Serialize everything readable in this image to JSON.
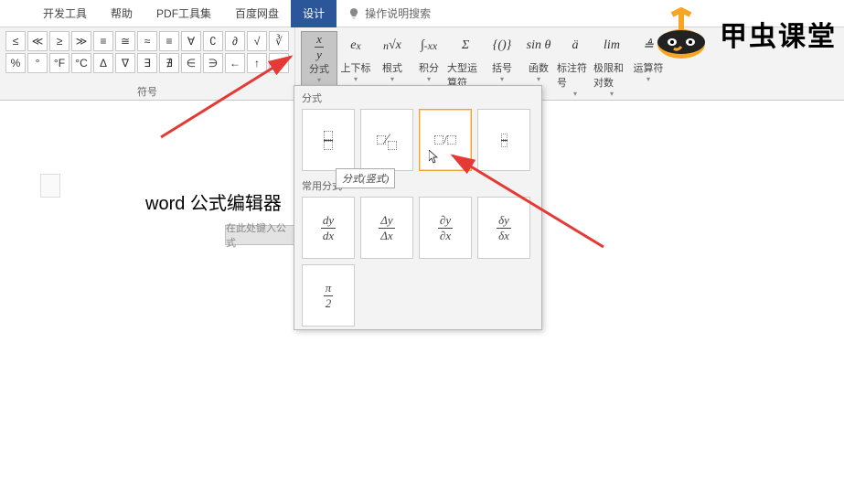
{
  "tabs": {
    "dev_tools": "开发工具",
    "help": "帮助",
    "pdf_tools": "PDF工具集",
    "baidu_netdisk": "百度网盘",
    "design": "设计",
    "tell_me_placeholder": "操作说明搜索"
  },
  "symbols_group_label": "符号",
  "symbols_row1": [
    "≤",
    "≪",
    "≥",
    "≫",
    "≡",
    "≅",
    "≈",
    "≡",
    "∀",
    "∁",
    "∂",
    "√",
    "∛"
  ],
  "symbols_row2": [
    "%",
    "°",
    "°F",
    "°C",
    "Δ",
    "∇",
    "∃",
    "∄",
    "∈",
    "∋",
    "←",
    "↑",
    "→"
  ],
  "equation_buttons": {
    "fraction": {
      "icon_html": "<span class='frac'><span class='num'>x</span><span class='bar'></span><span class='den'>y</span></span>",
      "label": "分式"
    },
    "script": {
      "icon_html": "e<sup>x</sup>",
      "label": "上下标"
    },
    "radical": {
      "icon_html": "<sup>n</sup>√x",
      "label": "根式"
    },
    "integral": {
      "icon_html": "∫<sub>-x</sub><sup>x</sup>",
      "label": "积分"
    },
    "large_op": {
      "icon_html": "Σ",
      "label": "大型运算符"
    },
    "bracket": {
      "icon_html": "{()}",
      "label": "括号"
    },
    "function": {
      "icon_html": "sin θ",
      "label": "函数"
    },
    "accent": {
      "icon_html": "ä",
      "label": "标注符号"
    },
    "limit": {
      "icon_html": "lim",
      "label": "极限和对数"
    },
    "operator": {
      "icon_html": "≜",
      "label": "运算符"
    }
  },
  "gallery": {
    "section1_title": "分式",
    "section2_title": "常用分式",
    "tooltip_text": "分式(竖式)",
    "common": {
      "dy_dx": {
        "num": "dy",
        "den": "dx"
      },
      "Dy_Dx": {
        "num": "Δy",
        "den": "Δx"
      },
      "pdy_pdx": {
        "num": "∂y",
        "den": "∂x"
      },
      "ddy_ddx": {
        "num": "δy",
        "den": "δx"
      },
      "pi_2": {
        "num": "π",
        "den": "2"
      }
    }
  },
  "document": {
    "title_text": "word 公式编辑器",
    "equation_placeholder": "在此处键入公式"
  },
  "watermark": {
    "brand_text": "甲虫课堂"
  }
}
